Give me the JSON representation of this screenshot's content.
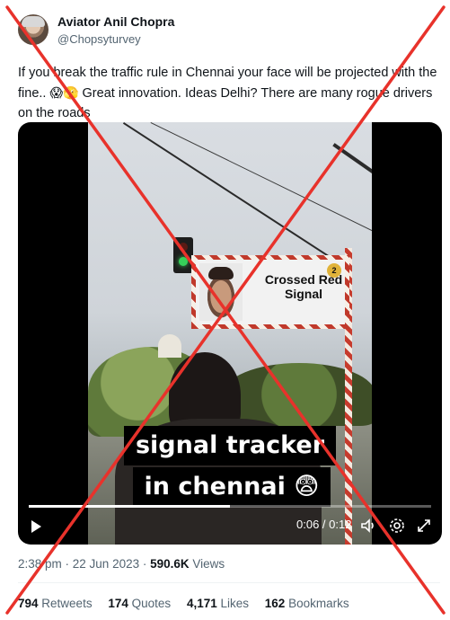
{
  "author": {
    "name": "Aviator Anil Chopra",
    "handle": "@Chopsyturvey"
  },
  "tweet": {
    "text_before": "If you break the traffic rule in Chennai your face will be projected with the fine.. ",
    "emojis": "😱🫣",
    "text_after": " Great innovation. Ideas Delhi? There are many rogue drivers on the roads"
  },
  "video": {
    "board_text": "Crossed Red Signal",
    "board_number": "2",
    "caption_line1": "signal tracker",
    "caption_line2": "in chennai 😨",
    "time_display": "0:06 / 0:12",
    "progress": 0.5,
    "icons": [
      "play-icon",
      "volume-icon",
      "settings-icon",
      "fullscreen-icon"
    ]
  },
  "meta": {
    "time": "2:38 pm",
    "separator": " · ",
    "date": "22 Jun 2023",
    "views_count": "590.6K",
    "views_label": " Views"
  },
  "stats": {
    "retweets_count": "794",
    "retweets_label": "Retweets",
    "quotes_count": "174",
    "quotes_label": "Quotes",
    "likes_count": "4,171",
    "likes_label": "Likes",
    "bookmarks_count": "162",
    "bookmarks_label": "Bookmarks"
  },
  "overlay": {
    "type": "false-claim-red-cross",
    "color": "#e8322b"
  }
}
